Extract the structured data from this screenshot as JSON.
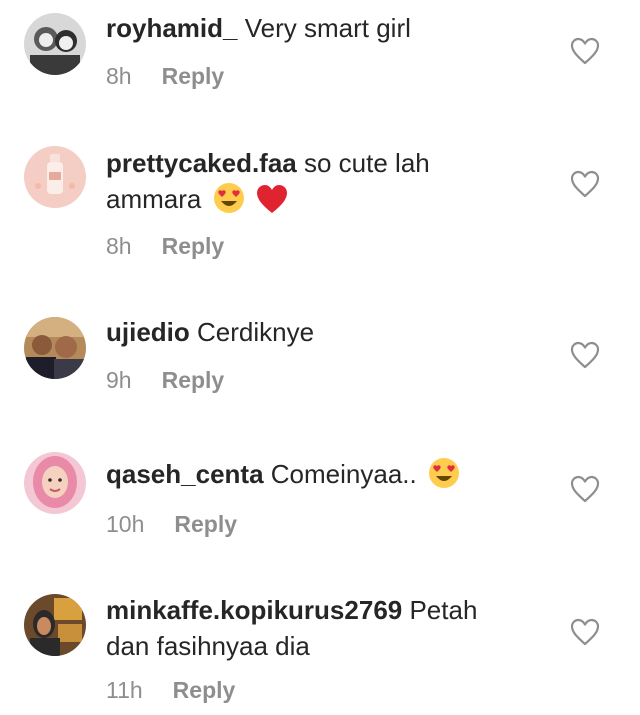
{
  "comments": [
    {
      "username": "royhamid_",
      "text": "Very smart girl",
      "time": "8h",
      "reply": "Reply",
      "avatar": "user-photo-two-people-bw"
    },
    {
      "username": "prettycaked.faa",
      "text_line1": "so cute lah",
      "text_line2": "ammara",
      "emojis": [
        "heart-eyes-emoji",
        "red-heart-emoji"
      ],
      "time": "8h",
      "reply": "Reply",
      "avatar": "pink-bottle-product-photo"
    },
    {
      "username": "ujiedio",
      "text": "Cerdiknye",
      "time": "9h",
      "reply": "Reply",
      "avatar": "group-selfie-photo"
    },
    {
      "username": "qaseh_centa",
      "text": "Comeinyaa..",
      "emojis": [
        "heart-eyes-emoji"
      ],
      "time": "10h",
      "reply": "Reply",
      "avatar": "woman-pink-hijab-photo"
    },
    {
      "username": "minkaffe.kopikurus2769",
      "text_line1": "Petah",
      "text_line2": "dan fasihnyaa dia",
      "time": "11h",
      "reply": "Reply",
      "avatar": "cafe-sign-photo"
    }
  ],
  "icons": {
    "like": "heart-outline-icon"
  },
  "colors": {
    "text": "#262626",
    "secondary": "#8e8e8e",
    "background": "#ffffff"
  }
}
